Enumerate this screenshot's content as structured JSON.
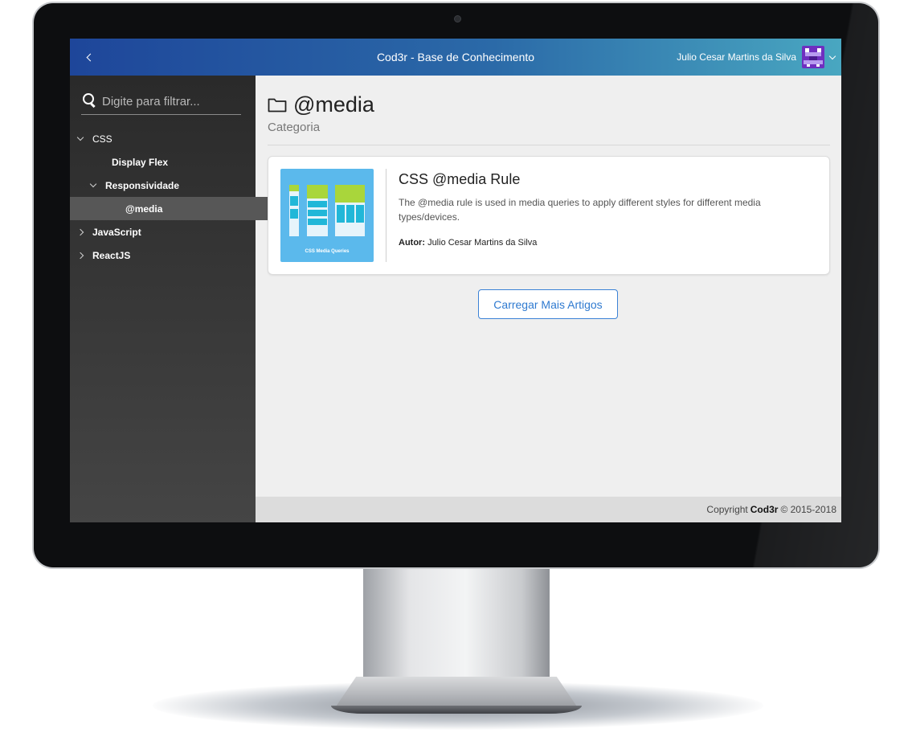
{
  "header": {
    "title": "Cod3r - Base de Conhecimento",
    "user_name": "Julio Cesar Martins da Silva",
    "toggle_icon": "chevron-left-icon",
    "avatar_color": "#6f2fc0"
  },
  "sidebar": {
    "search_placeholder": "Digite para filtrar...",
    "tree": [
      {
        "label": "CSS",
        "expanded": true,
        "level": 0
      },
      {
        "label": "Display Flex",
        "level": 1
      },
      {
        "label": "Responsividade",
        "expanded": true,
        "level": 1
      },
      {
        "label": "@media",
        "level": 2,
        "selected": true
      },
      {
        "label": "JavaScript",
        "expanded": false,
        "level": 0
      },
      {
        "label": "ReactJS",
        "expanded": false,
        "level": 0
      }
    ]
  },
  "main": {
    "page_title": "@media",
    "page_subtitle": "Categoria",
    "articles": [
      {
        "title": "CSS @media Rule",
        "description": "The @media rule is used in media queries to apply different styles for different media types/devices.",
        "author_label": "Autor:",
        "author_name": "Julio Cesar Martins da Silva",
        "thumbnail_caption": "CSS Media Queries"
      }
    ],
    "load_more_label": "Carregar Mais Artigos"
  },
  "footer": {
    "prefix": "Copyright",
    "brand": "Cod3r",
    "suffix": "© 2015-2018"
  },
  "colors": {
    "header_gradient_start": "#1e469a",
    "header_gradient_end": "#49a7c1",
    "accent": "#2f7ad0",
    "thumbnail_bg": "#5bb9ec"
  }
}
